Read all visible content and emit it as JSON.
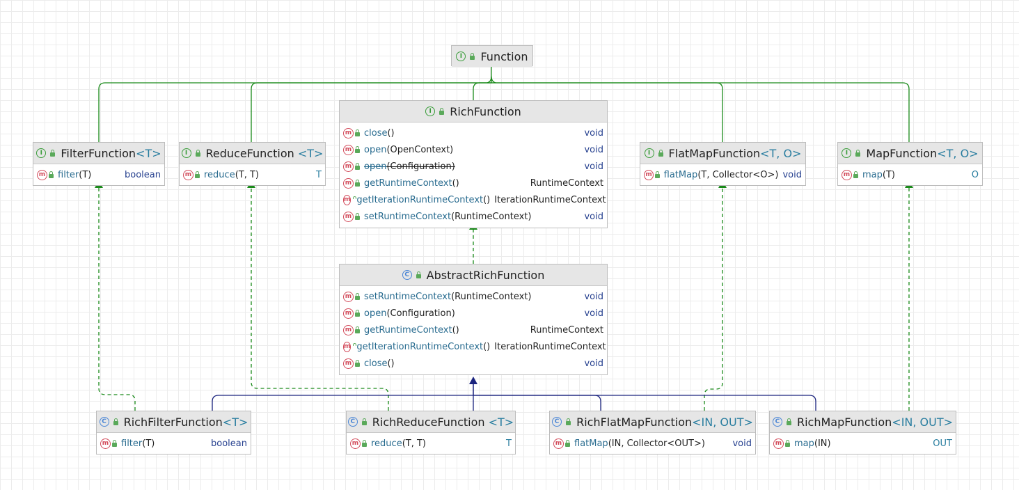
{
  "diagram": {
    "nodes": [
      {
        "id": "function",
        "kind": "interface",
        "name": "Function",
        "type_params": "",
        "members": []
      },
      {
        "id": "rich-function",
        "kind": "interface",
        "name": "RichFunction",
        "type_params": "",
        "members": [
          {
            "name": "close",
            "params": "()",
            "ret": "void"
          },
          {
            "name": "open",
            "params": "(OpenContext)",
            "ret": "void"
          },
          {
            "name": "open",
            "params": "(Configuration)",
            "ret": "void",
            "deprecated": true
          },
          {
            "name": "getRuntimeContext",
            "params": "()",
            "ret": "RuntimeContext"
          },
          {
            "name": "getIterationRuntimeContext",
            "params": "()",
            "ret": "IterationRuntimeContext"
          },
          {
            "name": "setRuntimeContext",
            "params": "(RuntimeContext)",
            "ret": "void"
          }
        ]
      },
      {
        "id": "filter-function",
        "kind": "interface",
        "name": "FilterFunction",
        "type_params": "<T>",
        "members": [
          {
            "name": "filter",
            "params": "(T)",
            "ret": "boolean"
          }
        ]
      },
      {
        "id": "reduce-function",
        "kind": "interface",
        "name": "ReduceFunction",
        "type_params": "<T>",
        "members": [
          {
            "name": "reduce",
            "params": "(T, T)",
            "ret": "T"
          }
        ]
      },
      {
        "id": "flatmap-function",
        "kind": "interface",
        "name": "FlatMapFunction",
        "type_params": "<T, O>",
        "members": [
          {
            "name": "flatMap",
            "params": "(T, Collector<O>)",
            "ret": "void"
          }
        ]
      },
      {
        "id": "map-function",
        "kind": "interface",
        "name": "MapFunction",
        "type_params": "<T, O>",
        "members": [
          {
            "name": "map",
            "params": "(T)",
            "ret": "O"
          }
        ]
      },
      {
        "id": "abstract-rich-function",
        "kind": "class",
        "name": "AbstractRichFunction",
        "type_params": "",
        "members": [
          {
            "name": "setRuntimeContext",
            "params": "(RuntimeContext)",
            "ret": "void"
          },
          {
            "name": "open",
            "params": "(Configuration)",
            "ret": "void"
          },
          {
            "name": "getRuntimeContext",
            "params": "()",
            "ret": "RuntimeContext"
          },
          {
            "name": "getIterationRuntimeContext",
            "params": "()",
            "ret": "IterationRuntimeContext"
          },
          {
            "name": "close",
            "params": "()",
            "ret": "void"
          }
        ]
      },
      {
        "id": "rich-filter-function",
        "kind": "class",
        "name": "RichFilterFunction",
        "type_params": "<T>",
        "members": [
          {
            "name": "filter",
            "params": "(T)",
            "ret": "boolean"
          }
        ]
      },
      {
        "id": "rich-reduce-function",
        "kind": "class",
        "name": "RichReduceFunction",
        "type_params": "<T>",
        "members": [
          {
            "name": "reduce",
            "params": "(T, T)",
            "ret": "T"
          }
        ]
      },
      {
        "id": "rich-flatmap-function",
        "kind": "class",
        "name": "RichFlatMapFunction",
        "type_params": "<IN, OUT>",
        "members": [
          {
            "name": "flatMap",
            "params": "(IN, Collector<OUT>)",
            "ret": "void"
          }
        ]
      },
      {
        "id": "rich-map-function",
        "kind": "class",
        "name": "RichMapFunction",
        "type_params": "<IN, OUT>",
        "members": [
          {
            "name": "map",
            "params": "(IN)",
            "ret": "OUT"
          }
        ]
      }
    ],
    "edges": [
      {
        "from": "filter-function",
        "to": "function",
        "type": "extends"
      },
      {
        "from": "reduce-function",
        "to": "function",
        "type": "extends"
      },
      {
        "from": "rich-function",
        "to": "function",
        "type": "extends"
      },
      {
        "from": "flatmap-function",
        "to": "function",
        "type": "extends"
      },
      {
        "from": "map-function",
        "to": "function",
        "type": "extends"
      },
      {
        "from": "abstract-rich-function",
        "to": "rich-function",
        "type": "implements"
      },
      {
        "from": "rich-filter-function",
        "to": "filter-function",
        "type": "implements"
      },
      {
        "from": "rich-reduce-function",
        "to": "reduce-function",
        "type": "implements"
      },
      {
        "from": "rich-flatmap-function",
        "to": "flatmap-function",
        "type": "implements"
      },
      {
        "from": "rich-map-function",
        "to": "map-function",
        "type": "implements"
      },
      {
        "from": "rich-filter-function",
        "to": "abstract-rich-function",
        "type": "extends-class"
      },
      {
        "from": "rich-reduce-function",
        "to": "abstract-rich-function",
        "type": "extends-class"
      },
      {
        "from": "rich-flatmap-function",
        "to": "abstract-rich-function",
        "type": "extends-class"
      },
      {
        "from": "rich-map-function",
        "to": "abstract-rich-function",
        "type": "extends-class"
      }
    ],
    "colors": {
      "interface_inheritance": "#1a8a1a",
      "class_inheritance": "#1a237e",
      "interface_icon": "#3b9d3b",
      "class_icon": "#4a86d6",
      "method_icon": "#d24a5a"
    }
  }
}
